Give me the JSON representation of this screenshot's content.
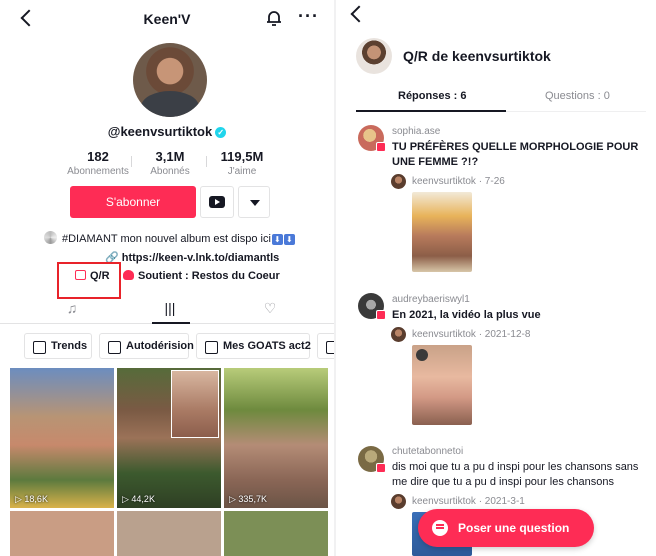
{
  "left": {
    "title": "Keen'V",
    "username": "@keenvsurtiktok",
    "stats": [
      {
        "value": "182",
        "label": "Abonnements"
      },
      {
        "value": "3,1M",
        "label": "Abonnés"
      },
      {
        "value": "119,5M",
        "label": "J'aime"
      }
    ],
    "follow_label": "S'abonner",
    "bio": "#DIAMANT mon nouvel album est dispo ici",
    "link": "https://keen-v.lnk.to/diamantls",
    "qr_label": "Q/R",
    "support_label": "Soutient : Restos du Coeur",
    "playlists": [
      "Trends",
      "Autodérision",
      "Mes GOATS act2"
    ],
    "videos": [
      {
        "views": "18,6K"
      },
      {
        "views": "44,2K"
      },
      {
        "views": "335,7K"
      }
    ]
  },
  "right": {
    "title": "Q/R de keenvsurtiktok",
    "tabs": {
      "answers": "Réponses : 6",
      "questions": "Questions : 0"
    },
    "questions": [
      {
        "author": "sophia.ase",
        "text": "TU PRÉFÈRES QUELLE MORPHOLOGIE POUR UNE FEMME ?!?",
        "responder": "keenvsurtiktok",
        "date": "· 7-26"
      },
      {
        "author": "audreybaeriswyl1",
        "text": "En 2021, la vidéo la plus vue",
        "responder": "keenvsurtiktok",
        "date": "· 2021-12-8"
      },
      {
        "author": "chutetabonnetoi",
        "text": "dis moi que tu a pu d inspi pour les chansons sans me dire que tu a pu d inspi pour les chansons",
        "responder": "keenvsurtiktok",
        "date": "· 2021-3-1"
      }
    ],
    "ask_label": "Poser une question"
  },
  "colors": {
    "brand": "#fe2c55",
    "highlight": "#e8232a",
    "verified": "#20d5ec"
  }
}
